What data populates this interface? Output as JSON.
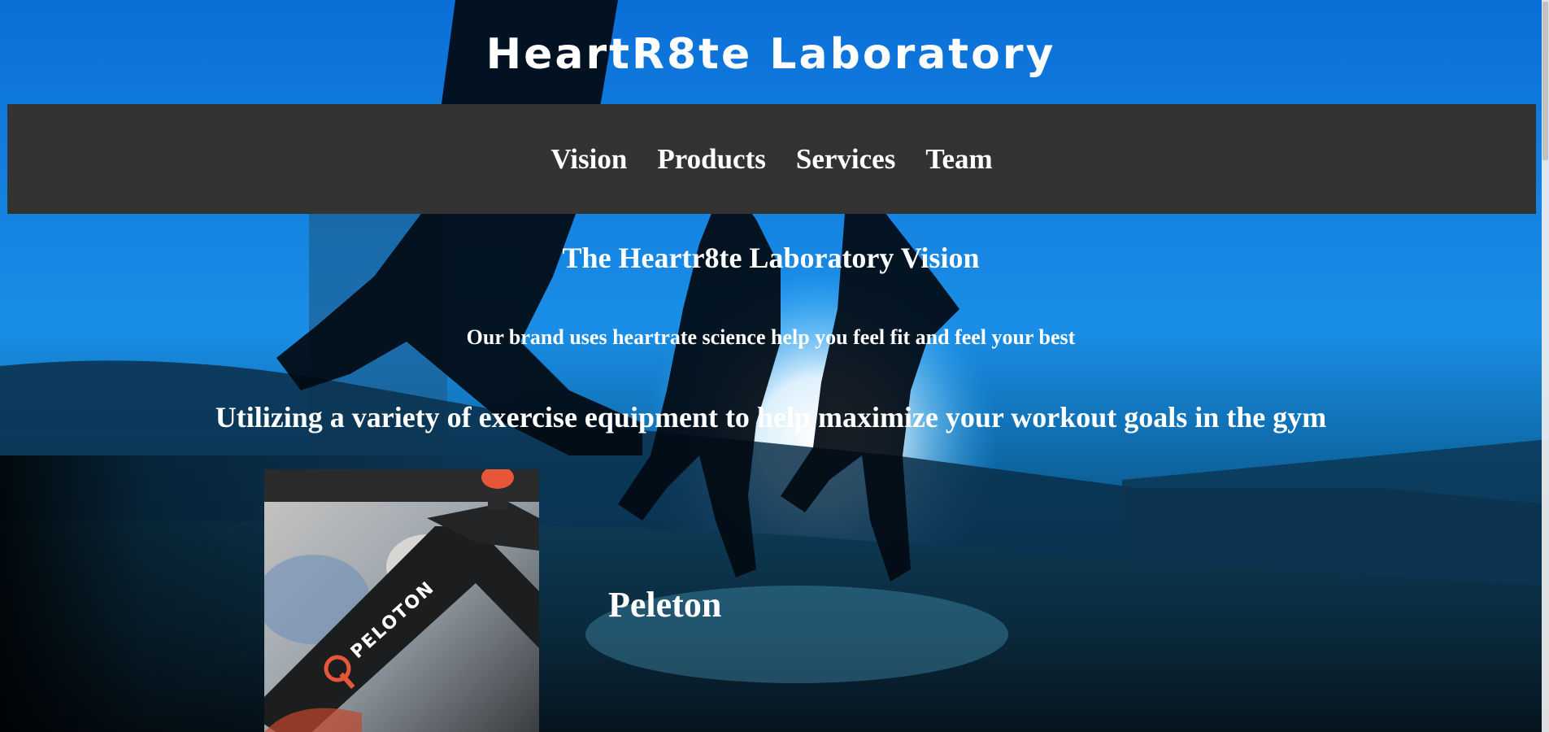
{
  "site": {
    "title": "HeartR8te Laboratory"
  },
  "nav": {
    "items": [
      {
        "label": "Vision"
      },
      {
        "label": "Products"
      },
      {
        "label": "Services"
      },
      {
        "label": "Team"
      }
    ]
  },
  "vision": {
    "heading": "The Heartr8te Laboratory Vision",
    "line1": "Our brand uses heartrate science help you feel fit and feel your best",
    "line2": "Utilizing a variety of exercise equipment to help maximize your workout goals in the gym"
  },
  "products": [
    {
      "name": "Peleton",
      "image_label": "PELOTON"
    }
  ],
  "colors": {
    "nav_background": "#333333",
    "text": "#ffffff",
    "sky_top": "#0a6fd8",
    "accent_orange": "#e8563a"
  }
}
